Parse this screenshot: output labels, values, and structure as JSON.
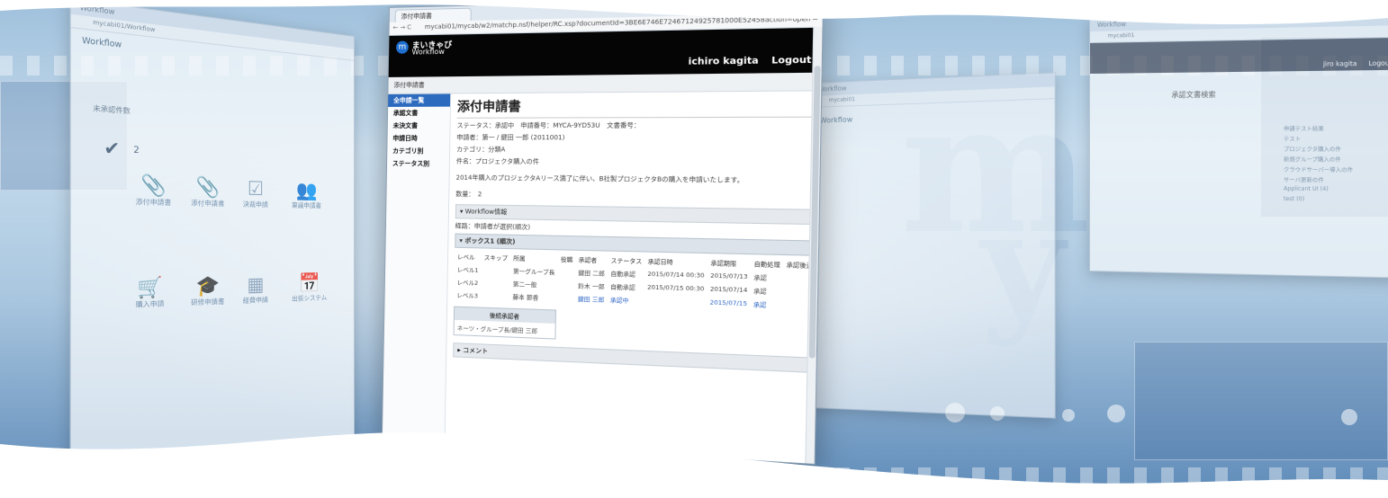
{
  "colors": {
    "accent": "#2d6bbf",
    "header_bg": "#050505",
    "sky": "#c5dbec"
  },
  "main_window": {
    "tab_label": "添付申請書",
    "url": "mycabi01/mycab/w2/matchp.nsf/helper/RC.xsp?documentId=3BE6E746E72467124925781000E52458action=open",
    "logo_jp": "まいきゃび",
    "logo_en": "Workflow",
    "user_name": "ichiro kagita",
    "logout_label": "Logout",
    "breadcrumb": "添付申請書",
    "sidebar": [
      {
        "label": "全申請一覧",
        "active": true
      },
      {
        "label": "承認文書",
        "active": false
      },
      {
        "label": "未決文書",
        "active": false
      },
      {
        "label": "申請日時",
        "active": false
      },
      {
        "label": "カテゴリ別",
        "active": false
      },
      {
        "label": "ステータス別",
        "active": false
      }
    ],
    "doc_title": "添付申請書",
    "status_line": "ステータス：承認中　申請番号：MYCA-9YD53U　文書番号：",
    "applicant_line": "申請者：第一 / 鍵田 一郎 (2011001)",
    "category_line": "カテゴリ：分類A",
    "subject_line": "件名：プロジェクタ購入の件",
    "body_line": "2014年購入のプロジェクタAリース満了に伴い、B社製プロジェクタBの購入を申請いたします。",
    "amount_line": "数量：　2",
    "workflow_section": "▾ Workflow情報",
    "route_label": "経路：申請者が選択(順次)",
    "box_label": "▾ ボックス1 (順次)",
    "table_headers": [
      "レベル",
      "スキップ",
      "所属",
      "役職",
      "承認者",
      "ステータス",
      "承認日時",
      "承認期限",
      "自動処理",
      "承認後通者"
    ],
    "rows": [
      {
        "level": "レベル1",
        "dept": "第一グループ長",
        "approver": "鍵田 二郎",
        "status": "自動承認",
        "date": "2015/07/14 00:30",
        "limit": "2015/07/13",
        "auto": "承認"
      },
      {
        "level": "レベル2",
        "dept": "第二一般",
        "approver": "鈴木 一郎",
        "status": "自動承認",
        "date": "2015/07/15 00:30",
        "limit": "2015/07/14",
        "auto": "承認"
      },
      {
        "level": "レベル3",
        "dept": "藤本 節香",
        "approver": "鍵田 三郎",
        "status": "承認中",
        "date": "",
        "limit": "2015/07/15",
        "auto": "承認"
      }
    ],
    "approver_box_title": "後続承認者",
    "approver_box_value": "ネーツ・グループ長/鍵田 三郎",
    "comment_section": "▸ コメント"
  },
  "left_window": {
    "logo_en": "Workflow",
    "count_label": "未承認件数",
    "count_value": "2",
    "icons": [
      {
        "name": "添付申請書",
        "glyph": "📎"
      },
      {
        "name": "添付申請書",
        "glyph": "📎"
      },
      {
        "name": "決裁申請",
        "glyph": "☑"
      },
      {
        "name": "稟議申請書",
        "glyph": "👥"
      },
      {
        "name": "購入申請",
        "glyph": "🛒"
      },
      {
        "name": "研修申請書",
        "glyph": "🎓"
      },
      {
        "name": "経費申請",
        "glyph": "▦"
      },
      {
        "name": "出張システム",
        "glyph": "📅"
      }
    ]
  },
  "right_window": {
    "user_name": "jiro kagita",
    "logout_label": "Logout",
    "title": "承認文書検索",
    "links": [
      "申請テスト結果",
      "テスト",
      "プロジェクタ購入の件",
      "新規グループ購入の件",
      "クラウドサーバー導入の件",
      "サーバ更新の件",
      "Applicant UI (4)",
      "test (0)"
    ]
  },
  "center_window": {
    "logo_en": "Workflow"
  }
}
